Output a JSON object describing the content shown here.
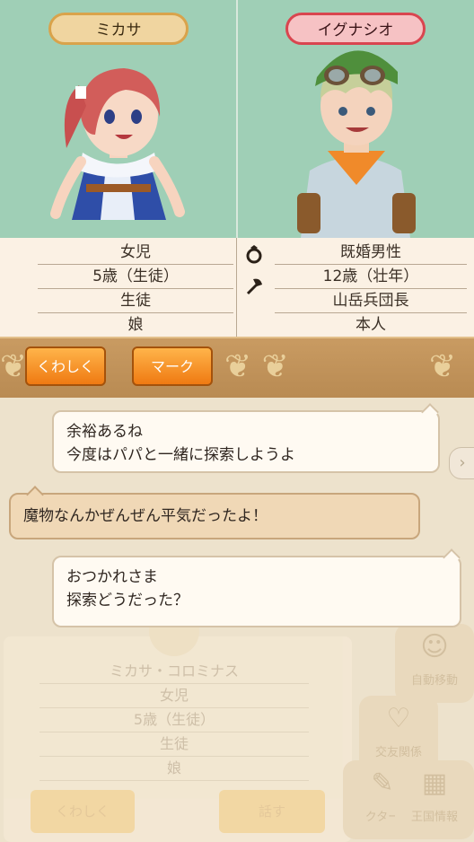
{
  "left_character": {
    "name": "ミカサ",
    "attributes": [
      "女児",
      "5歳（生徒）",
      "生徒",
      "娘"
    ]
  },
  "right_character": {
    "name": "イグナシオ",
    "attributes": [
      "既婚男性",
      "12歳（壮年）",
      "山岳兵団長",
      "本人"
    ]
  },
  "icons": {
    "ring": "ring-icon",
    "axe": "axe-icon"
  },
  "actions": {
    "detail_label": "くわしく",
    "mark_label": "マーク"
  },
  "messages": [
    {
      "speaker": "right",
      "text_line1": "余裕あるね",
      "text_line2": "今度はパパと一緒に探索しようよ"
    },
    {
      "speaker": "left",
      "text_line1": "魔物なんかぜんぜん平気だったよ！"
    },
    {
      "speaker": "right",
      "text_line1": "おつかれさま",
      "text_line2": "探索どうだった？"
    }
  ],
  "background_panel": {
    "full_name": "ミカサ・コロミナス",
    "rows": [
      "女児",
      "5歳（生徒）",
      "生徒",
      "娘"
    ],
    "detail_label": "くわしく",
    "talk_label": "話す",
    "menu": [
      "自動移動",
      "交友関係",
      "クター",
      "王国情報"
    ]
  },
  "colors": {
    "accent_orange": "#ef7a12",
    "left_pill": "#f0d5a0",
    "right_pill": "#f6c2c4",
    "portrait_bg": "#9fcfb6"
  }
}
